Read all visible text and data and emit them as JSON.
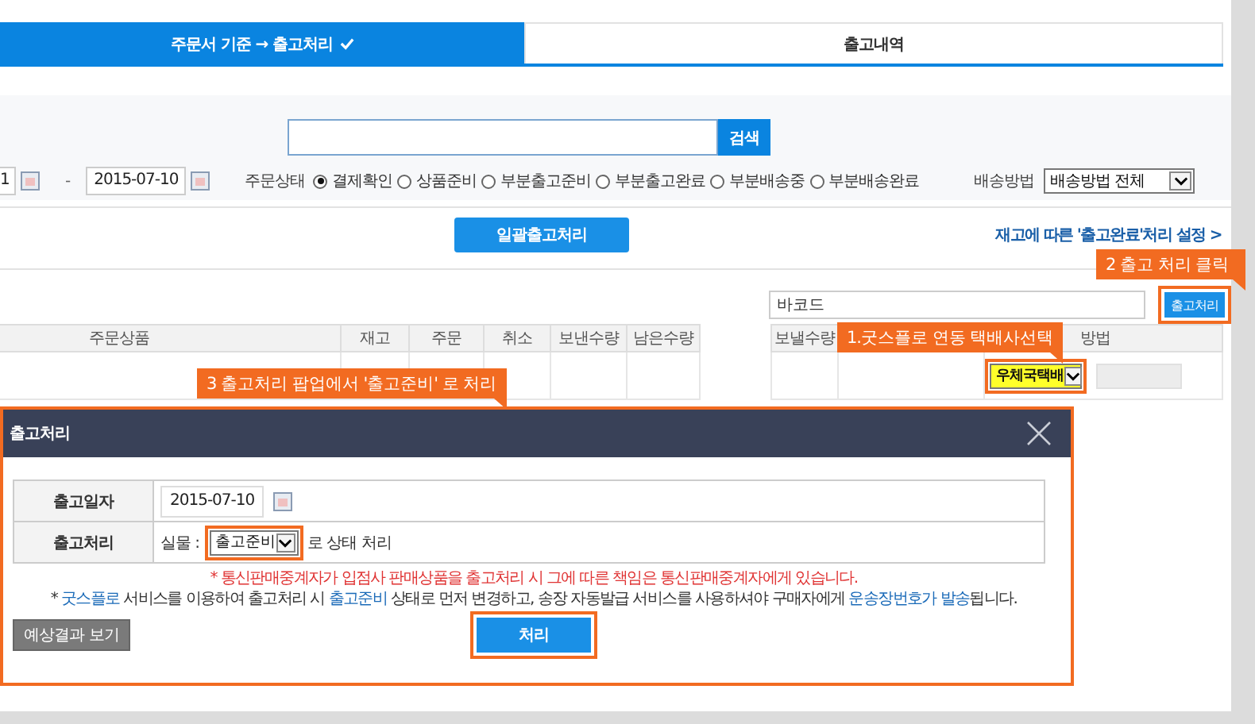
{
  "tabs": [
    {
      "label": "주문서 기준 → 출고처리",
      "selected": true,
      "checked": true
    },
    {
      "label": "출고내역",
      "selected": false,
      "checked": false
    }
  ],
  "search": {
    "button": "검색"
  },
  "filter": {
    "date_from": "1",
    "date_separator": "-",
    "date_to": "2015-07-10",
    "status_label": "주문상태",
    "statuses": [
      {
        "label": "결제확인",
        "selected": true
      },
      {
        "label": "상품준비",
        "selected": false
      },
      {
        "label": "부분출고준비",
        "selected": false
      },
      {
        "label": "부분출고완료",
        "selected": false
      },
      {
        "label": "부분배송중",
        "selected": false
      },
      {
        "label": "부분배송완료",
        "selected": false
      }
    ],
    "shipping_label": "배송방법",
    "shipping_select": "배송방법 전체"
  },
  "bulk_button": "일괄출고처리",
  "settings_link": "재고에 따른 '출고완료'처리 설정 >",
  "barcode": {
    "placeholder": "바코드"
  },
  "ship_button": "출고처리",
  "table": {
    "columns": [
      "주문상품",
      "재고",
      "주문",
      "취소",
      "보낸수량",
      "남은수량"
    ],
    "right_columns": [
      "보낼수량",
      "방법"
    ],
    "courier_select": "우체국택배"
  },
  "callouts": [
    {
      "label": "1.굿스플로 연동 택배사선택"
    },
    {
      "label": "2 출고 처리 클릭"
    },
    {
      "label": "3 출고처리 팝업에서 '출고준비' 로 처리"
    }
  ],
  "modal": {
    "title": "출고처리",
    "rows": [
      {
        "kind": "date",
        "label": "출고일자",
        "value": "2015-07-10"
      },
      {
        "kind": "status",
        "label": "출고처리",
        "prefix": "실물 :",
        "select": "출고준비",
        "suffix": "로 상태 처리"
      }
    ],
    "warning": "* 통신판매중계자가 입점사 판매상품을 출고처리 시 그에 따른 책임은 통신판매중계자에게 있습니다.",
    "note": [
      {
        "text": "* ",
        "link": false
      },
      {
        "text": "굿스플로",
        "link": true
      },
      {
        "text": " 서비스를 이용하여 출고처리 시 ",
        "link": false
      },
      {
        "text": "출고준비",
        "link": true
      },
      {
        "text": " 상태로 먼저 변경하고, 송장 자동발급 서비스를 사용하셔야 구매자에게 ",
        "link": false
      },
      {
        "text": "운송장번호가 발송",
        "link": true
      },
      {
        "text": "됩니다.",
        "link": false
      }
    ],
    "preview_button": "예상결과 보기",
    "process_button": "처리"
  }
}
